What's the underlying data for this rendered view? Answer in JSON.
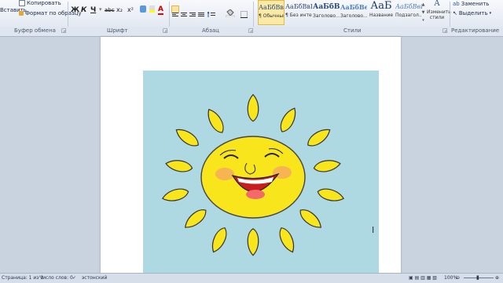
{
  "clipboard": {
    "paste_label": "Вставить",
    "copy_label": "Копировать",
    "format_painter_label": "Формат по образцу",
    "group_label": "Буфер обмена"
  },
  "font": {
    "bold": "Ж",
    "italic": "К",
    "underline": "Ч",
    "strike": "abc",
    "subscript": "x₂",
    "superscript": "x²",
    "text_color_letter": "A",
    "group_label": "Шрифт"
  },
  "paragraph": {
    "group_label": "Абзац"
  },
  "styles": {
    "group_label": "Стили",
    "items": [
      {
        "sample": "АаБбВвГ",
        "name": "¶ Обычный"
      },
      {
        "sample": "АаБбВвГ",
        "name": "¶ Без инте..."
      },
      {
        "sample": "АаБбВ",
        "name": "Заголово..."
      },
      {
        "sample": "АаБбВе",
        "name": "Заголово..."
      },
      {
        "sample": "АаБ",
        "name": "Название"
      },
      {
        "sample": "АаБбВвЕ",
        "name": "Подзагол..."
      }
    ],
    "change_styles_label": "Изменить стили"
  },
  "editing": {
    "replace_label": "Заменить",
    "select_label": "Выделить",
    "group_label": "Редактирование"
  },
  "status": {
    "page": "Страница: 1 из 2",
    "words": "Число слов: 0",
    "language": "эстонский",
    "zoom": "100%"
  },
  "colors": {
    "sun_yellow": "#f9e51c",
    "sky_blue": "#aed8e2",
    "accent_blue": "#2b579a"
  }
}
